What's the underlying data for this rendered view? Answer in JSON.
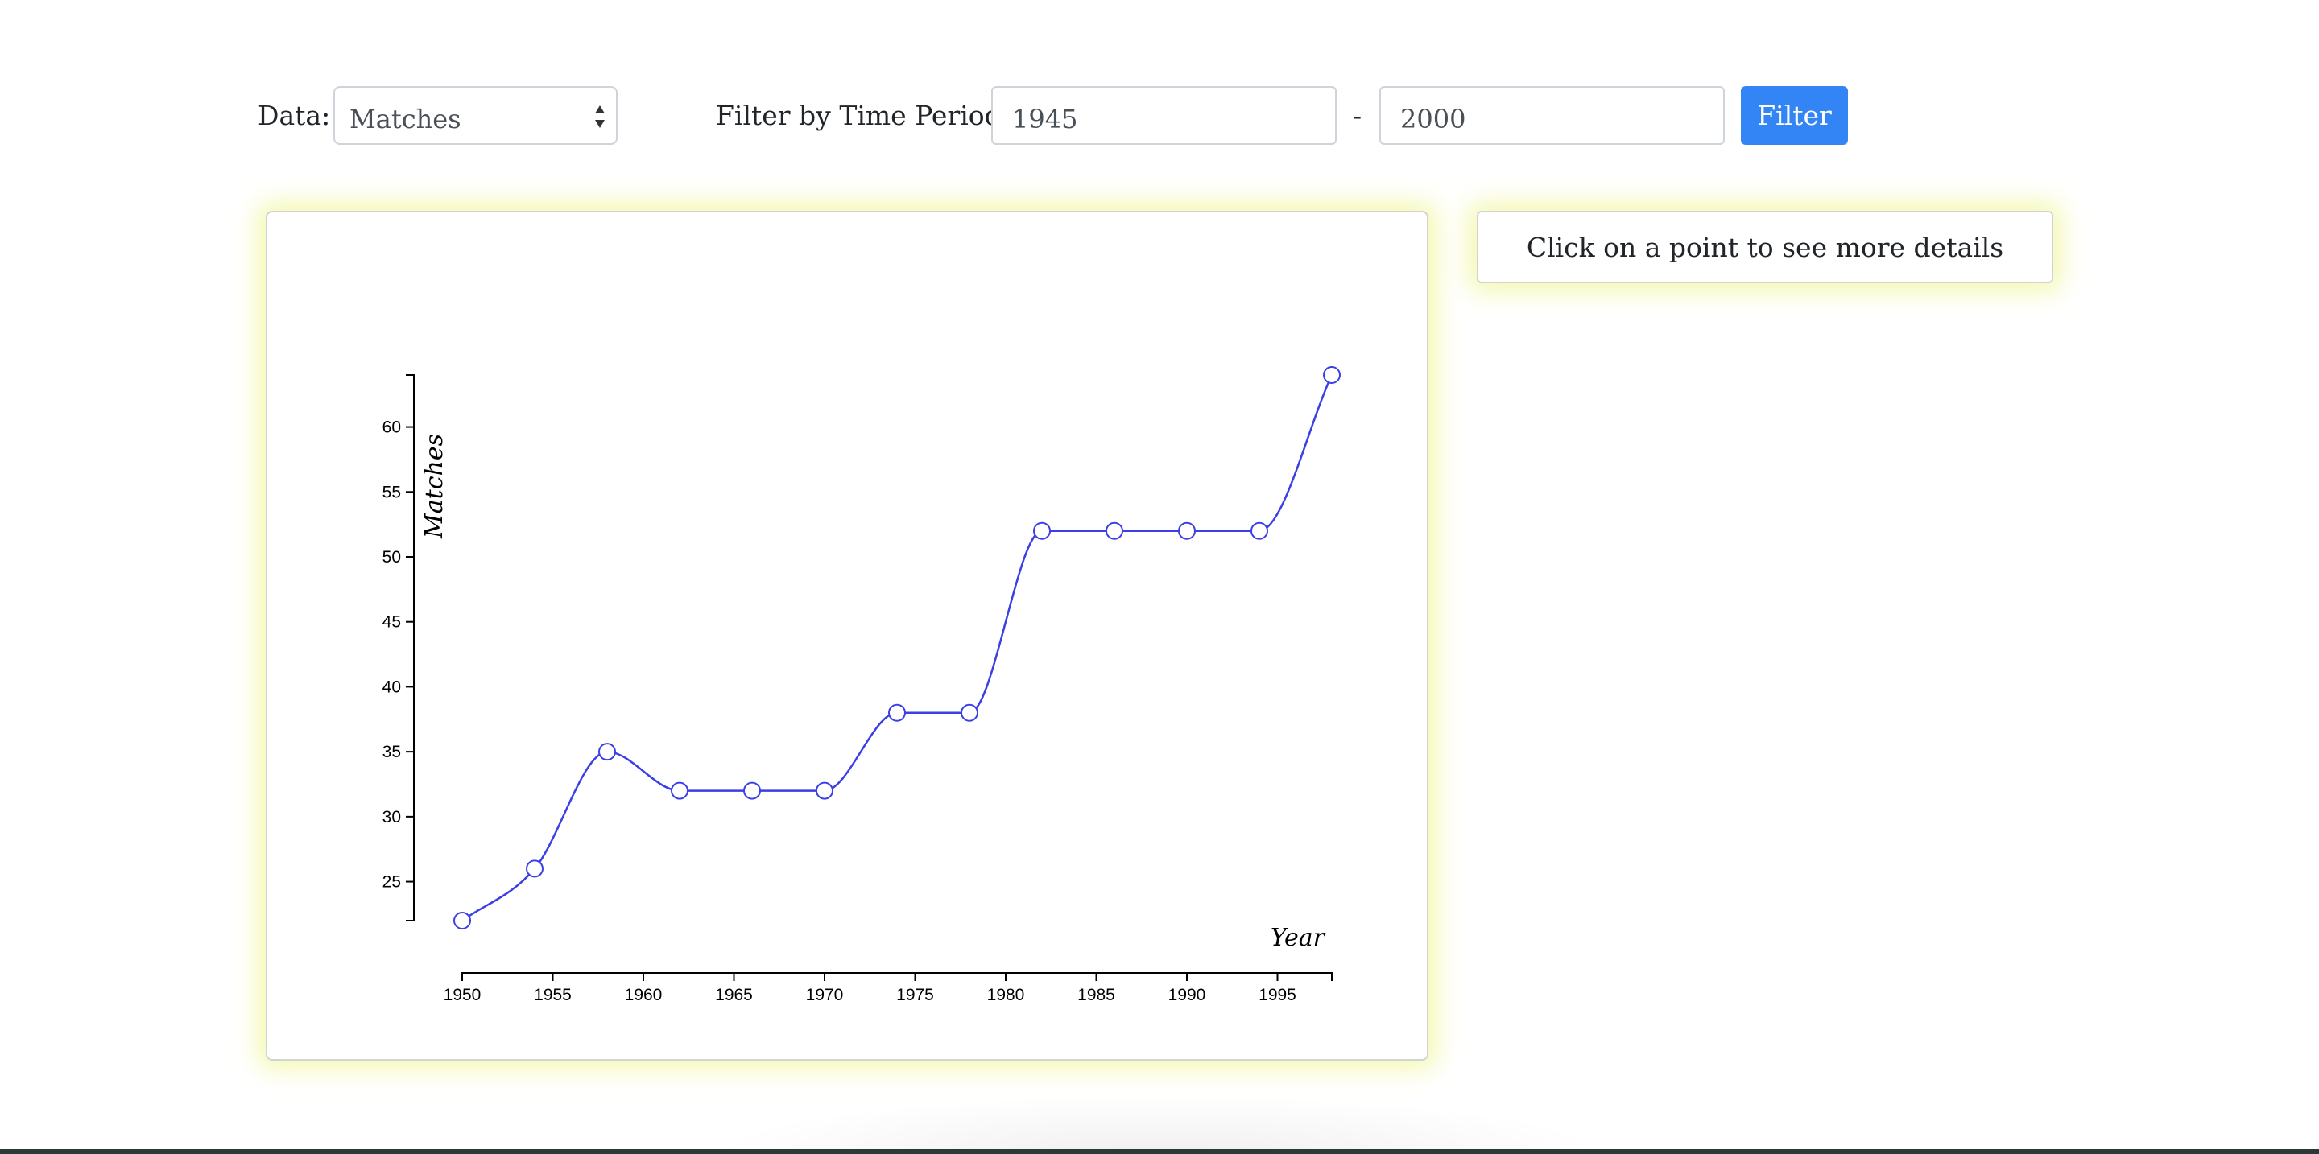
{
  "controls": {
    "data_label": "Data:",
    "data_select_value": "Matches",
    "period_label": "Filter by Time Period:",
    "period_from": "1945",
    "period_separator": "-",
    "period_to": "2000",
    "filter_button": "Filter"
  },
  "details": {
    "message": "Click on a point to see more details"
  },
  "colors": {
    "line": "#3b3fe6",
    "button": "#3385f5",
    "highlight": "#f0f596"
  },
  "chart_data": {
    "type": "line",
    "xlabel": "Year",
    "ylabel": "Matches",
    "xlim": [
      1950,
      1998
    ],
    "ylim": [
      22,
      64
    ],
    "xticks": [
      1950,
      1955,
      1960,
      1965,
      1970,
      1975,
      1980,
      1985,
      1990,
      1995
    ],
    "yticks": [
      25,
      30,
      35,
      40,
      45,
      50,
      55,
      60
    ],
    "points": [
      {
        "x": 1950,
        "y": 22
      },
      {
        "x": 1954,
        "y": 26
      },
      {
        "x": 1958,
        "y": 35
      },
      {
        "x": 1962,
        "y": 32
      },
      {
        "x": 1966,
        "y": 32
      },
      {
        "x": 1970,
        "y": 32
      },
      {
        "x": 1974,
        "y": 38
      },
      {
        "x": 1978,
        "y": 38
      },
      {
        "x": 1982,
        "y": 52
      },
      {
        "x": 1986,
        "y": 52
      },
      {
        "x": 1990,
        "y": 52
      },
      {
        "x": 1994,
        "y": 52
      },
      {
        "x": 1998,
        "y": 64
      }
    ],
    "grid": false,
    "legend": "none"
  }
}
